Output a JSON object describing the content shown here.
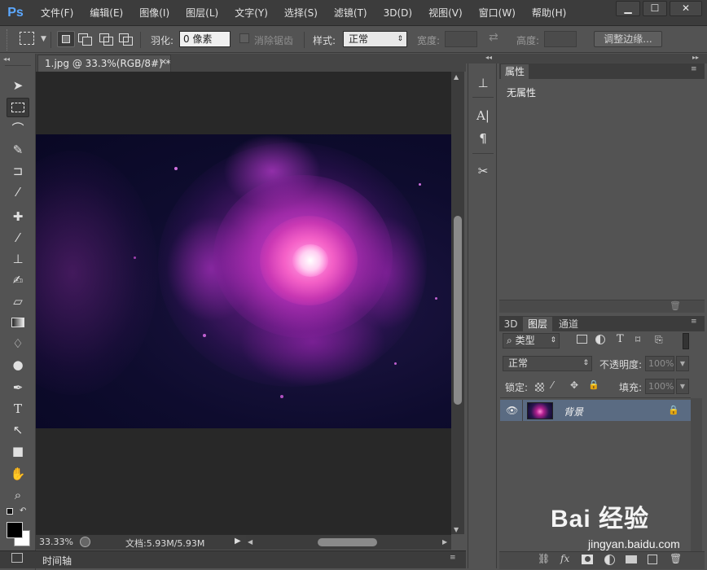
{
  "app": {
    "logo": "Ps"
  },
  "menu": [
    "文件(F)",
    "编辑(E)",
    "图像(I)",
    "图层(L)",
    "文字(Y)",
    "选择(S)",
    "滤镜(T)",
    "3D(D)",
    "视图(V)",
    "窗口(W)",
    "帮助(H)"
  ],
  "window_controls": {
    "minimize": "▁",
    "maximize": "☐",
    "close": "✕"
  },
  "options": {
    "feather_label": "羽化:",
    "feather_value": "0 像素",
    "antialias_label": "消除锯齿",
    "style_label": "样式:",
    "style_value": "正常",
    "width_label": "宽度:",
    "height_label": "高度:",
    "refine_edge": "调整边缘..."
  },
  "document": {
    "tab_title": "1.jpg @ 33.3%(RGB/8#) *",
    "tab_close": "×",
    "zoom": "33.33%",
    "doc_info": "文档:5.93M/5.93M"
  },
  "timeline": {
    "label": "时间轴"
  },
  "properties": {
    "tab": "属性",
    "empty_text": "无属性"
  },
  "layers": {
    "tabs": [
      "3D",
      "图层",
      "通道"
    ],
    "filter_kind": "类型",
    "blend_mode": "正常",
    "opacity_label": "不透明度:",
    "opacity_value": "100%",
    "lock_label": "锁定:",
    "fill_label": "填充:",
    "fill_value": "100%",
    "rows": [
      {
        "name": "背景",
        "visible": true,
        "locked": true
      }
    ]
  },
  "watermark": {
    "brand": "Bai 经验",
    "url": "jingyan.baidu.com"
  },
  "colors": {
    "accent": "#5ca8ff",
    "selected_layer": "#5a6b82",
    "canvas_bg": "#282828",
    "panel_bg": "#535353"
  }
}
